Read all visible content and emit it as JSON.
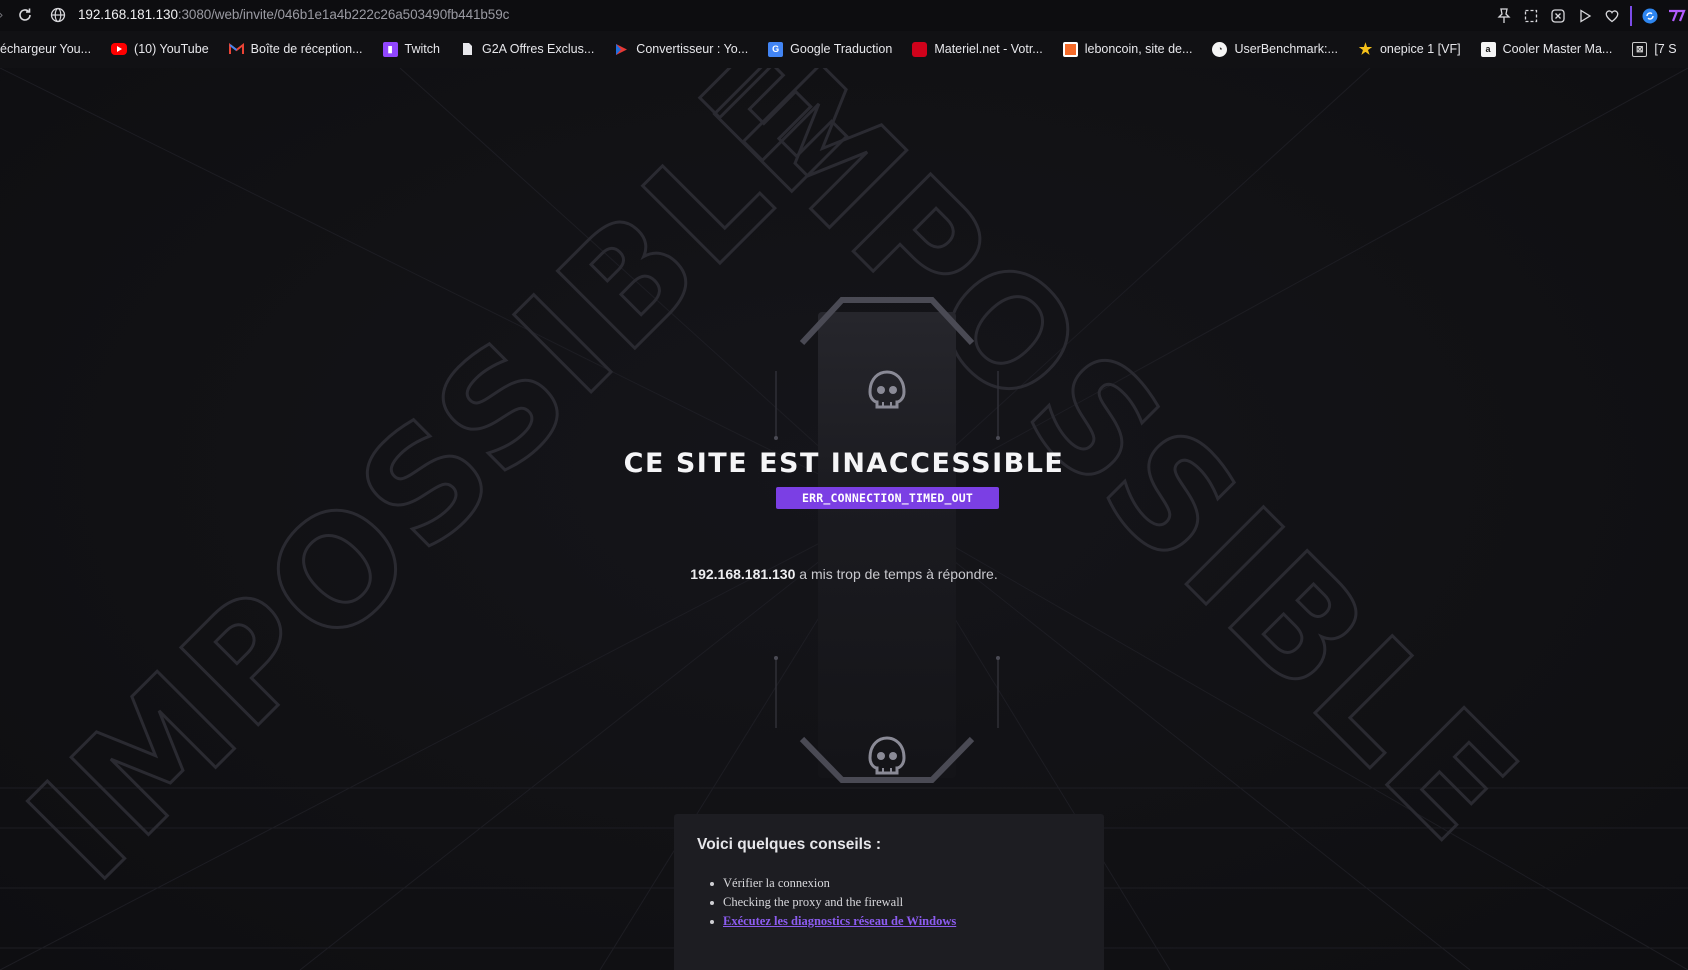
{
  "browser": {
    "url_host": "192.168.181.130",
    "url_path": ":3080/web/invite/046b1e1a4b222c26a503490fb441b59c",
    "accent_color": "#7b3fe4"
  },
  "bookmarks": [
    {
      "label": "échargeur You...",
      "icon": "download-icon"
    },
    {
      "label": "(10) YouTube",
      "icon": "youtube-icon"
    },
    {
      "label": "Boîte de réception...",
      "icon": "gmail-icon"
    },
    {
      "label": "Twitch",
      "icon": "twitch-icon"
    },
    {
      "label": "G2A Offres Exclus...",
      "icon": "page-icon"
    },
    {
      "label": "Convertisseur : Yo...",
      "icon": "converter-icon"
    },
    {
      "label": "Google Traduction",
      "icon": "translate-icon"
    },
    {
      "label": "Materiel.net - Votr...",
      "icon": "materiel-icon"
    },
    {
      "label": "leboncoin, site de...",
      "icon": "leboncoin-icon"
    },
    {
      "label": "UserBenchmark:...",
      "icon": "userbenchmark-icon"
    },
    {
      "label": "onepice 1 [VF]",
      "icon": "star-icon"
    },
    {
      "label": "Cooler Master Ma...",
      "icon": "amazon-icon"
    },
    {
      "label": "[7 S",
      "icon": "image-icon"
    }
  ],
  "extensions": [
    "pin-icon",
    "screenshot-icon",
    "shield-x-icon",
    "play-icon",
    "heart-icon",
    "sync-icon",
    "logo-icon"
  ],
  "page": {
    "background_word": "IMPOSSIBLE",
    "title": "CE SITE EST INACCESSIBLE",
    "error_code": "ERR_CONNECTION_TIMED_OUT",
    "message_host": "192.168.181.130",
    "message_text": " a mis trop de temps à répondre.",
    "tips_title": "Voici quelques conseils :",
    "tips": [
      "Vérifier la connexion",
      "Checking the proxy and the firewall"
    ],
    "tips_link": "Exécutez les diagnostics réseau de Windows"
  }
}
